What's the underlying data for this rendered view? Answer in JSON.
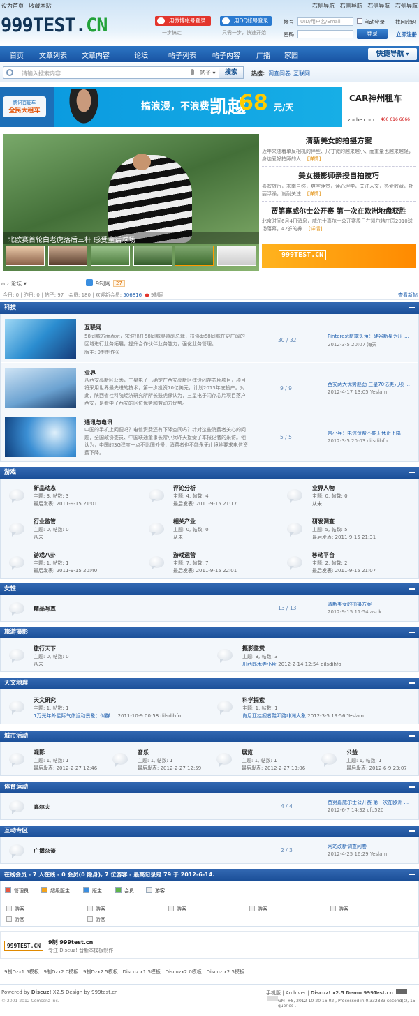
{
  "top": {
    "links_left": [
      "设为首页",
      "收藏本站"
    ],
    "links_right": [
      "右侧导航",
      "右侧导航",
      "右侧导航",
      "右侧导航"
    ]
  },
  "logo": {
    "main": "999TEST.",
    "accent": "CN"
  },
  "social": {
    "weibo": "用微博帐号登录",
    "qq": "用QQ帐号登录",
    "note1": "一步搞定",
    "note2": "只需一步，快速开始"
  },
  "login": {
    "account_label": "帐号",
    "account_ph": "UID/用户名/Email",
    "password_label": "密码",
    "auto": "自动登录",
    "forgot": "找回密码",
    "submit": "登录",
    "register": "立即注册"
  },
  "nav": {
    "items": [
      "首页",
      "文章列表",
      "文章内容",
      "论坛",
      "帖子列表",
      "帖子内容",
      "广播",
      "家园"
    ],
    "quick": "快捷导航"
  },
  "search": {
    "placeholder": "请输入搜索内容",
    "type": "帖子",
    "button": "搜索",
    "hot_label": "热搜:",
    "hot": [
      "调查问卷",
      "互联网"
    ]
  },
  "banner": {
    "left1": "腾讯百能车",
    "left2": "全民大租车",
    "slogan": "搞浪漫，不浪费",
    "car": "凯越",
    "price": "68",
    "unit": "元/天",
    "brand": "CAR神州租车",
    "site": "zuche.com",
    "phone": "400 616 6666"
  },
  "slide": {
    "caption": "北欧赛首轮白老虎落后三杆  感受童话球场"
  },
  "news": [
    {
      "title": "清新美女的拍摄方案",
      "desc": "近年来随着单反相机的伴型、尺寸微的越来越小、而重量也越来越轻，身边爱好拍照的人...",
      "more": "[详情]"
    },
    {
      "title": "美女摄影师亲授自拍技巧",
      "desc": "喜欢旅行，乖南自然，爽空睡觉，读心理学，关注人文，热爱收藏，牡丽浮躁，谢耐关注...",
      "more": "[详情]"
    },
    {
      "title": "贾第嘉威尔士公开赛 第一次在欧洲地盘获胜",
      "desc": "北京时间6月4日消息，威尔士嘉尔士公开赛周日在凯尔特庄园2010球场落幕，42岁的养...",
      "more": "[详情]"
    }
  ],
  "side_logo": "999TEST.CN",
  "crumb": {
    "home": "论坛",
    "forum": "9制网",
    "count": "27"
  },
  "stats": {
    "text": "今日: 0 | 昨日: 0 | 帖子: 97 | 会员: 180 | 欢迎新会员: ",
    "member": "506816",
    "weibo": "9制网",
    "latest": "查看新帖"
  },
  "sections": [
    {
      "title": "科技",
      "forums": [
        {
          "name": "互联网",
          "desc": "58同城方面表示，宋波出任58同城渠道副总裁，将协助58同城在更广阔的区域进行业务拓展，提升合作伙伴业务能力，强化业务管理。",
          "mod": "版主: 9制制作①",
          "count": "30 / 32",
          "last": "Pinterest崭露头角：硅谷新星为压 ...",
          "meta": "2012-3-5 20:07 海天"
        },
        {
          "name": "业界",
          "desc": "从西安高新区获悉，三星电子已确定在西安高新区建设闪存芯片项目，项目将采用世界最先进的技术，第一步投资70亿美元，计划2013年底投产。对此，陕西省社科院经济研究所所长鼓虎保认为，三星电子闪存芯片项目落户西安，是看中了西安的区位优势和劳动力优势。",
          "mod": "",
          "count": "9 / 9",
          "last": "西安两大优势赵劲 三星70亿美元项 ...",
          "meta": "2012-4-17 13:05 Yeslam"
        },
        {
          "name": "通讯与电讯",
          "desc": "中国的手机上网便吗？电信资费还有下降空间吗？针对这些消费者关心的问题，全国政协委员、中国联通董事长常小兵昨天接受了本报记者的采访。他认为，中国的3G建度一点不比国外慢，消费者也不能永无止境地要求电信资费下降。",
          "mod": "",
          "count": "5 / 5",
          "last": "常小兵：电信资费不能无休止下降",
          "meta": "2012-3-5 20:03 dilsdihfo"
        }
      ]
    },
    {
      "title": "游戏",
      "cells": [
        {
          "name": "新品动态",
          "s1": "主题: 3, 帖数: 3",
          "s2": "最后发表: 2011-9-15 21:01"
        },
        {
          "name": "评论分析",
          "s1": "主题: 4, 帖数: 4",
          "s2": "最后发表: 2011-9-15 21:17"
        },
        {
          "name": "业界人物",
          "s1": "主题: 0, 帖数: 0",
          "s2": "从未"
        },
        {
          "name": "行业监管",
          "s1": "主题: 0, 帖数: 0",
          "s2": "从未"
        },
        {
          "name": "相关产业",
          "s1": "主题: 0, 帖数: 0",
          "s2": "从未"
        },
        {
          "name": "研发调查",
          "s1": "主题: 5, 帖数: 5",
          "s2": "最后发表: 2011-9-15 21:31"
        },
        {
          "name": "游戏八卦",
          "s1": "主题: 1, 帖数: 1",
          "s2": "最后发表: 2011-9-15 20:40"
        },
        {
          "name": "游戏运营",
          "s1": "主题: 7, 帖数: 7",
          "s2": "最后发表: 2011-9-15 22:01"
        },
        {
          "name": "移动平台",
          "s1": "主题: 2, 帖数: 2",
          "s2": "最后发表: 2011-9-15 21:07"
        }
      ]
    },
    {
      "title": "女性",
      "forums": [
        {
          "name": "精品写真",
          "count": "13 / 13",
          "last": "清新美女的拍摄方案",
          "meta": "2012-9-15 11:54 aspk"
        }
      ]
    },
    {
      "title": "旅游摄影",
      "cells": [
        {
          "name": "旅行天下",
          "s1": "主题: 0, 帖数: 0",
          "s2": "从未"
        },
        {
          "name": "摄影鉴赏",
          "s1": "主题: 3, 帖数: 3",
          "s2link": "川西郎木寺小片",
          "s2": "2012-2-14 12:54 dilsdihfo"
        }
      ]
    },
    {
      "title": "天文地理",
      "cells": [
        {
          "name": "天文研究",
          "s1": "主题: 1, 帖数: 1",
          "s2link": "1万光年外星际气体运动景象：似群 ...",
          "s2": "2011-10-9 00:58 dilsdihfo"
        },
        {
          "name": "科学探索",
          "s1": "主题: 1, 帖数: 1",
          "s2link": "肯尼亚挂掘者鞋叩路非洲大象",
          "s2": "2012-3-5 19:56 Yeslam"
        }
      ]
    },
    {
      "title": "城市活动",
      "cells": [
        {
          "name": "观影",
          "s1": "主题: 1, 帖数: 1",
          "s2": "最后发表: 2012-2-27 12:46"
        },
        {
          "name": "音乐",
          "s1": "主题: 1, 帖数: 1",
          "s2": "最后发表: 2012-2-27 12:59"
        },
        {
          "name": "展览",
          "s1": "主题: 1, 帖数: 1",
          "s2": "最后发表: 2012-2-27 13:06"
        },
        {
          "name": "公益",
          "s1": "主题: 1, 帖数: 1",
          "s2": "最后发表: 2012-6-9 23:07"
        }
      ]
    },
    {
      "title": "体育运动",
      "forums": [
        {
          "name": "高尔夫",
          "count": "4 / 4",
          "last": "贾第嘉威尔士公开赛 第一次在欧洲 ...",
          "meta": "2012-6-7 14:32 cfp520"
        }
      ]
    },
    {
      "title": "互动专区",
      "forums": [
        {
          "name": "广播杂谈",
          "count": "2 / 3",
          "last": "网站改新调查问卷",
          "meta": "2012-4-25 16:29 Yeslam"
        }
      ]
    }
  ],
  "online": {
    "title": "在线会员 - 7 人在线 - 0 会员(0 隐身), 7 位游客 - 最高记录是 79 于 2012-6-14.",
    "legend": [
      "管理员",
      "超级版主",
      "版主",
      "会员",
      "游客"
    ],
    "guest": "游客"
  },
  "flogo": {
    "name": "9制 999test.cn",
    "desc": "专注 Discuz! 音新本模板制作"
  },
  "flinks": [
    "9制Dzx1.5模板",
    "9制Dzx2.0模板",
    "9制Dzx2.5模板",
    "Discuz x1.5模板",
    "Discuzx2.0模板",
    "Discuz x2.5模板"
  ],
  "footer": {
    "powered": "Powered by ",
    "dz": "Discuz!",
    "ver": " X2.5 Design by 999test.cn",
    "copy": "© 2001-2012 Comsenz Inc.",
    "mobile": "手机版",
    "archiver": "Archiver",
    "demo": "Discuz! x2.5 Demo 999Test.cn",
    "info": "GMT+8, 2012-10-20 16:02 , Processed in 0.332833 second(s), 15 queries ."
  }
}
